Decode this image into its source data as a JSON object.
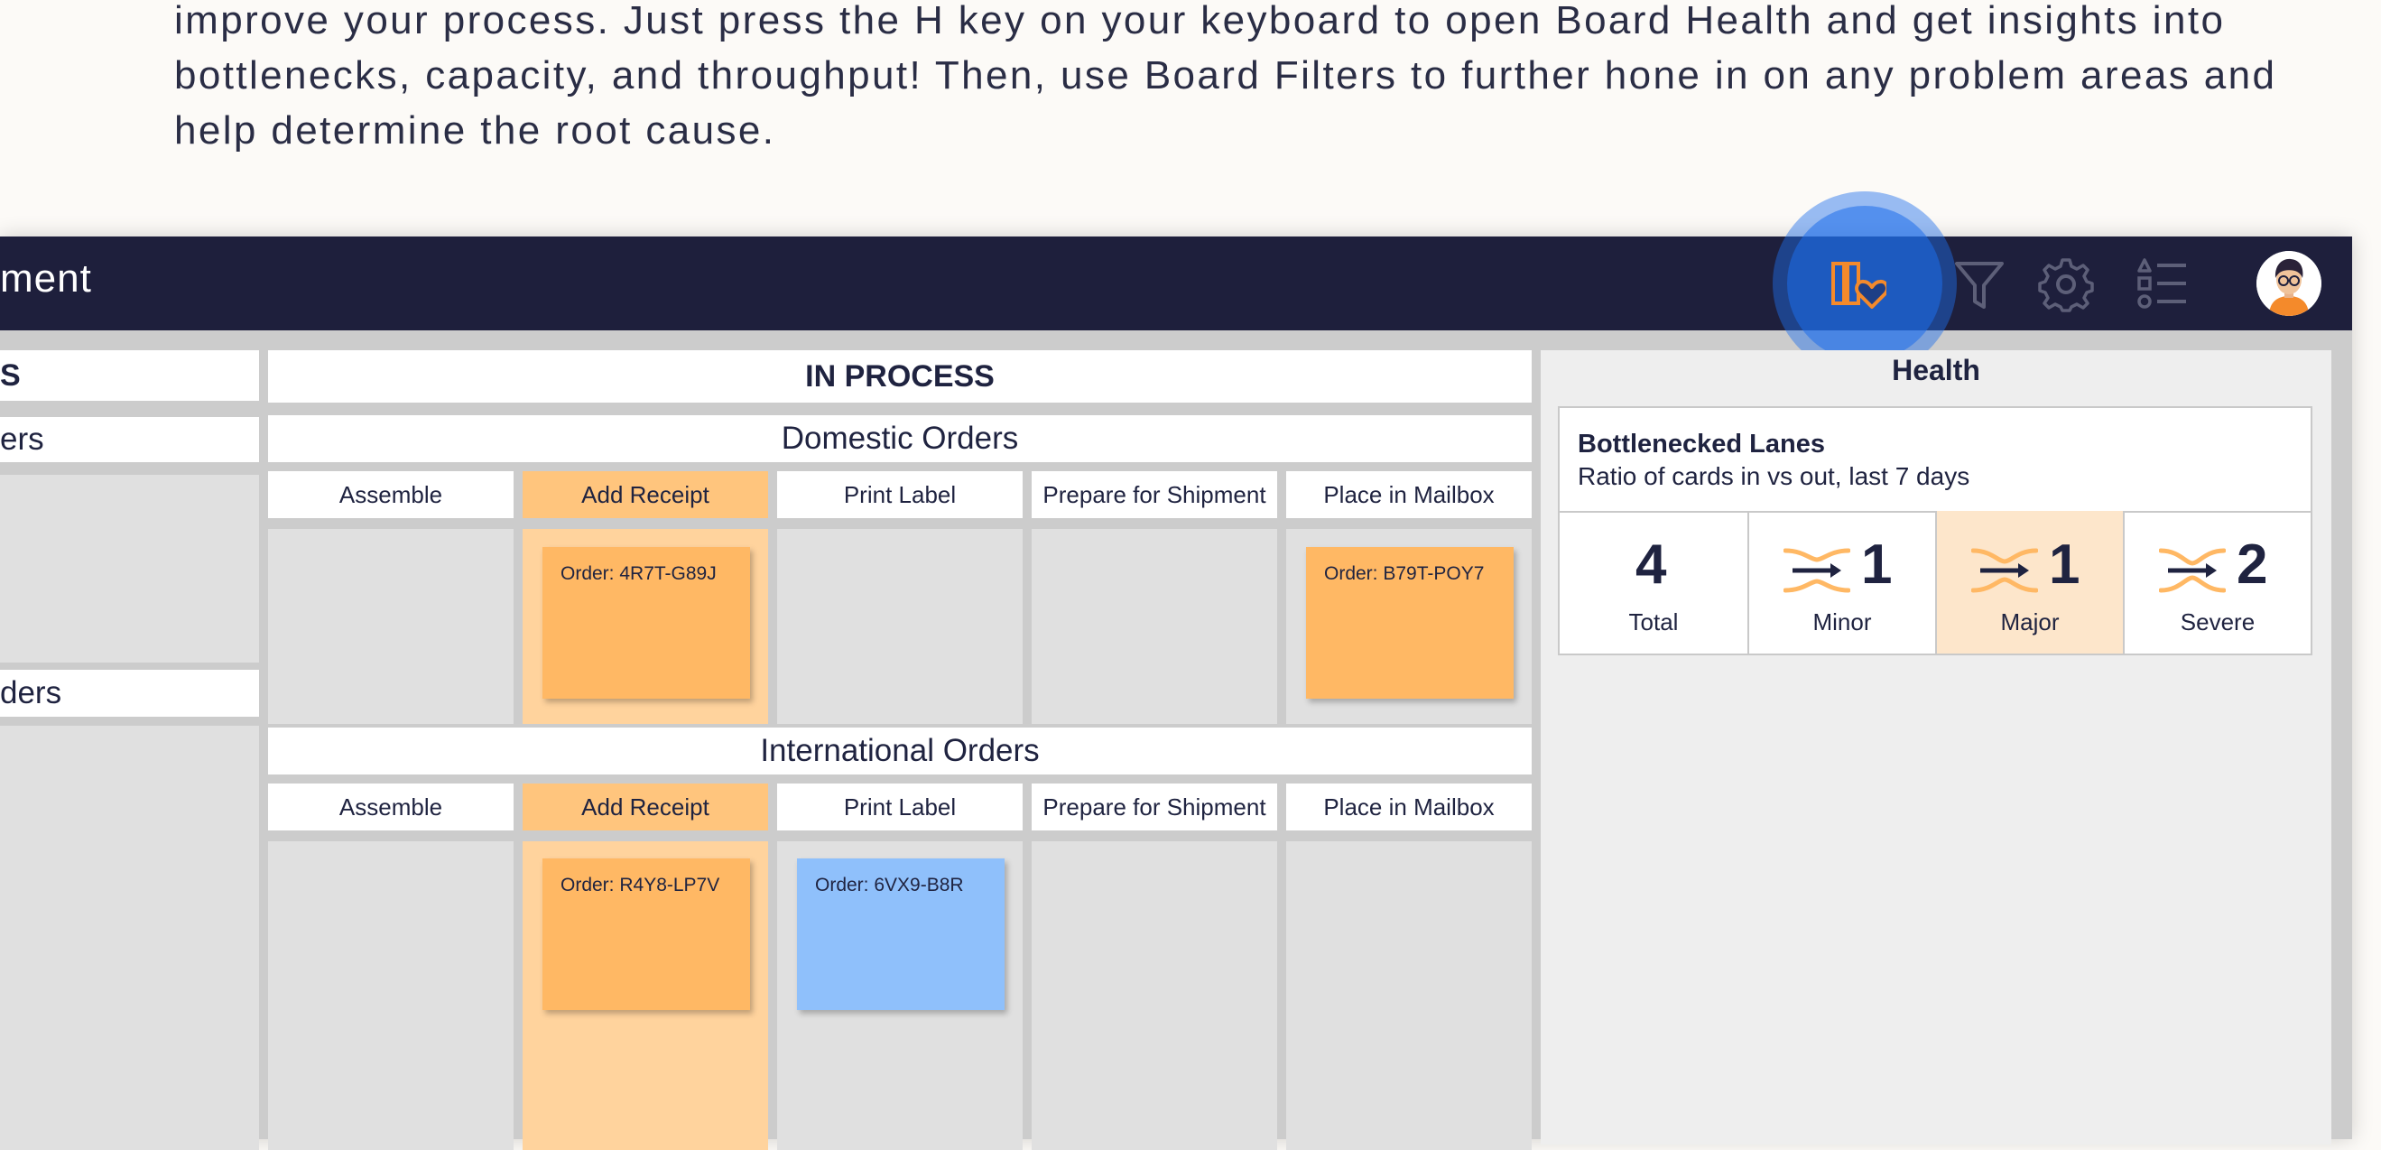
{
  "intro": {
    "line1": "improve your process. Just press the H key on your keyboard to open Board Health and get insights into",
    "line2": "bottlenecks, capacity, and throughput! Then, use Board Filters to further hone in on any problem areas and",
    "line3": "help determine the root cause."
  },
  "app": {
    "title": "ment"
  },
  "toolbar": {
    "icons": [
      "board-health-icon",
      "filter-icon",
      "settings-icon",
      "list-icon",
      "avatar"
    ]
  },
  "board": {
    "left_column": {
      "header": "S",
      "lane1": "ers",
      "lane2": "ders"
    },
    "in_process": {
      "header": "IN PROCESS",
      "domestic": {
        "title": "Domestic Orders",
        "columns": [
          "Assemble",
          "Add Receipt",
          "Print Label",
          "Prepare for Shipment",
          "Place in Mailbox"
        ],
        "cards": [
          "Order: 4R7T-G89J",
          "Order: B79T-POY7"
        ]
      },
      "international": {
        "title": "International Orders",
        "columns": [
          "Assemble",
          "Add Receipt",
          "Print Label",
          "Prepare for Shipment",
          "Place in Mailbox"
        ],
        "cards": [
          "Order: R4Y8-LP7V",
          "Order: 6VX9-B8R"
        ]
      }
    }
  },
  "health": {
    "title": "Health",
    "metric_title": "Bottlenecked Lanes",
    "metric_subtitle": "Ratio of cards in vs out, last 7 days",
    "stats": [
      {
        "value": "4",
        "label": "Total"
      },
      {
        "value": "1",
        "label": "Minor"
      },
      {
        "value": "1",
        "label": "Major"
      },
      {
        "value": "2",
        "label": "Severe"
      }
    ]
  },
  "colors": {
    "topbar": "#1e1f3c",
    "accent_orange": "#f48a2b",
    "card_orange": "#ffb864",
    "card_blue": "#8fc0fb",
    "highlight": "#1e6eeb"
  }
}
